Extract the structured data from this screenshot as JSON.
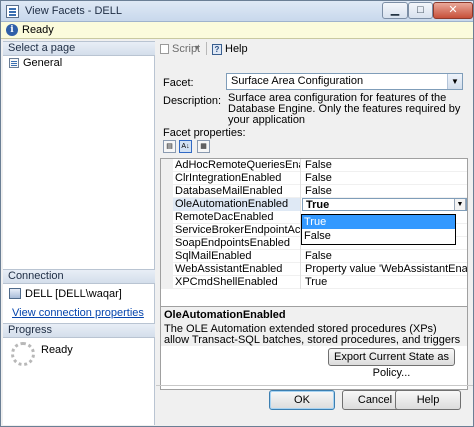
{
  "window": {
    "title": "View Facets - DELL",
    "close_glyph": "✕",
    "min_glyph": "▁",
    "max_glyph": "□"
  },
  "status": {
    "icon": "info-icon",
    "text": "Ready"
  },
  "left": {
    "select_header": "Select a page",
    "pages": [
      {
        "label": "General",
        "icon": "page-icon"
      }
    ],
    "connection_header": "Connection",
    "connection": "DELL [DELL\\waqar]",
    "connection_link": "View connection properties",
    "progress_header": "Progress",
    "progress_status": "Ready"
  },
  "toolbar": {
    "script_label": "Script",
    "help_label": "Help",
    "dropdown_glyph": "▾"
  },
  "facet": {
    "label": "Facet:",
    "value": "Surface Area Configuration",
    "description_label": "Description:",
    "description": "Surface area configuration for features of the Database Engine. Only the features required by your application"
  },
  "facet_properties_label": "Facet properties:",
  "grid_toolbar": {
    "categorized_icon": "▤",
    "alphabetical_icon": "A↓",
    "pages_icon": "▦"
  },
  "properties": [
    {
      "name": "AdHocRemoteQueriesEnabled",
      "value": "False"
    },
    {
      "name": "ClrIntegrationEnabled",
      "value": "False"
    },
    {
      "name": "DatabaseMailEnabled",
      "value": "False"
    },
    {
      "name": "OleAutomationEnabled",
      "value": "True",
      "selected": true
    },
    {
      "name": "RemoteDacEnabled",
      "value": ""
    },
    {
      "name": "ServiceBrokerEndpointActive",
      "value": ""
    },
    {
      "name": "SoapEndpointsEnabled",
      "value": ""
    },
    {
      "name": "SqlMailEnabled",
      "value": "False"
    },
    {
      "name": "WebAssistantEnabled",
      "value": "Property value 'WebAssistantEnabled' is n"
    },
    {
      "name": "XPCmdShellEnabled",
      "value": "True"
    }
  ],
  "dropdown": {
    "options": [
      "True",
      "False"
    ],
    "highlighted": "True",
    "arrow": "▼"
  },
  "help": {
    "title": "OleAutomationEnabled",
    "body": "The OLE Automation extended stored procedures (XPs) allow Transact-SQL batches, stored procedures, and triggers to reference custom OLE Automati..."
  },
  "export_button": "Export Current State as Policy...",
  "buttons": {
    "ok": "OK",
    "cancel": "Cancel",
    "help": "Help"
  }
}
